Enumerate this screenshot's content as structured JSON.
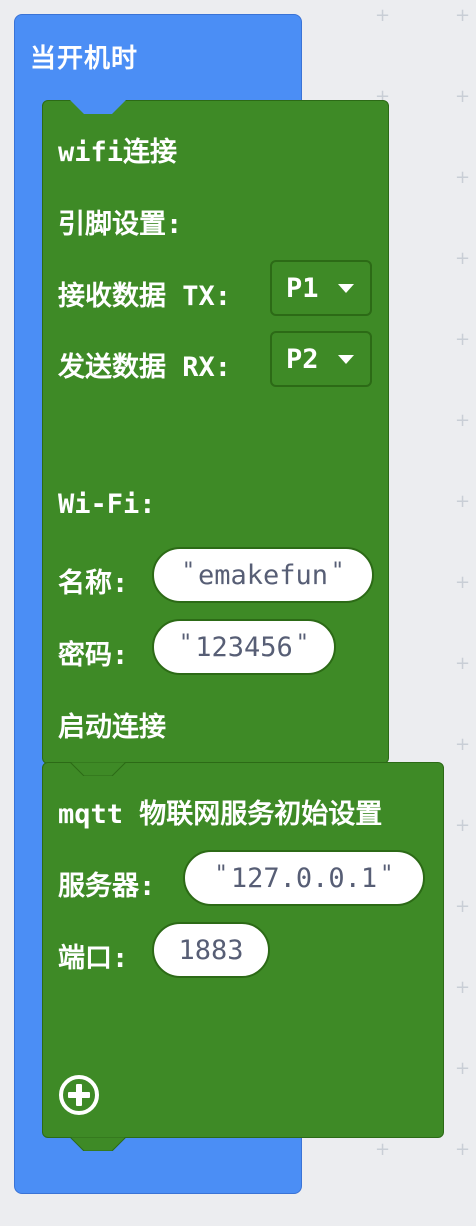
{
  "hat": {
    "title": "当开机时"
  },
  "wifi_block": {
    "title": "wifi连接",
    "pin_setup_label": "引脚设置:",
    "tx_label": "接收数据 TX:",
    "tx_value": "P1",
    "rx_label": "发送数据 RX:",
    "rx_value": "P2",
    "wifi_label": "Wi-Fi:",
    "ssid_label": "名称:",
    "ssid_value": "emakefun",
    "password_label": "密码:",
    "password_value": "123456",
    "start_label": "启动连接"
  },
  "mqtt_block": {
    "title": "mqtt 物联网服务初始设置",
    "server_label": "服务器:",
    "server_value": "127.0.0.1",
    "port_label": "端口:",
    "port_value": "1883"
  },
  "colors": {
    "background": "#ecedf0",
    "hat_blue": "#4b8ef5",
    "block_green": "#3e8a26",
    "block_border": "#2c6a16",
    "field_text": "#575e75"
  },
  "icons": {
    "dropdown": "caret-down-icon",
    "add": "plus-circle-icon"
  }
}
